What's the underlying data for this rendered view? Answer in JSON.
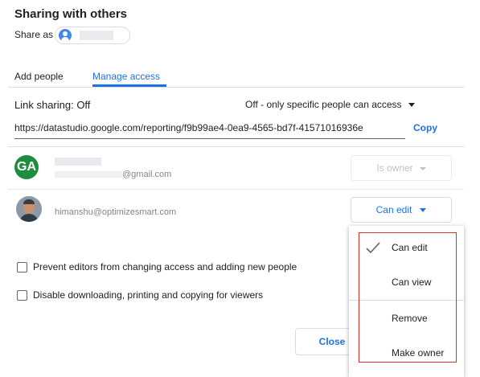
{
  "dialog": {
    "title": "Sharing with others",
    "share_as_label": "Share as"
  },
  "tabs": [
    {
      "label": "Add people",
      "active": false
    },
    {
      "label": "Manage access",
      "active": true
    }
  ],
  "link_sharing": {
    "label": "Link sharing: Off",
    "setting": "Off - only specific people can access",
    "url": "https://datastudio.google.com/reporting/f9b99ae4-0ea9-4565-bd7f-41571016936e",
    "copy_label": "Copy"
  },
  "people": [
    {
      "avatar_initials": "GA",
      "avatar_color": "#1e8e3e",
      "email": "@gmail.com",
      "role": "Is owner",
      "role_enabled": false
    },
    {
      "avatar_icon": "user-photo",
      "email": "himanshu@optimizesmart.com",
      "role": "Can edit",
      "role_enabled": true
    }
  ],
  "options": [
    {
      "label": "Prevent editors from changing access and adding new people",
      "checked": false
    },
    {
      "label": "Disable downloading, printing and copying for viewers",
      "checked": false
    }
  ],
  "footer": {
    "close_label": "Close"
  },
  "role_menu": {
    "items": [
      {
        "label": "Can edit",
        "selected": true
      },
      {
        "label": "Can view",
        "selected": false
      },
      {
        "label": "Remove",
        "selected": false
      },
      {
        "label": "Make owner",
        "selected": false
      }
    ]
  },
  "colors": {
    "accent": "#1a73e8",
    "highlight_border": "#d93025"
  }
}
